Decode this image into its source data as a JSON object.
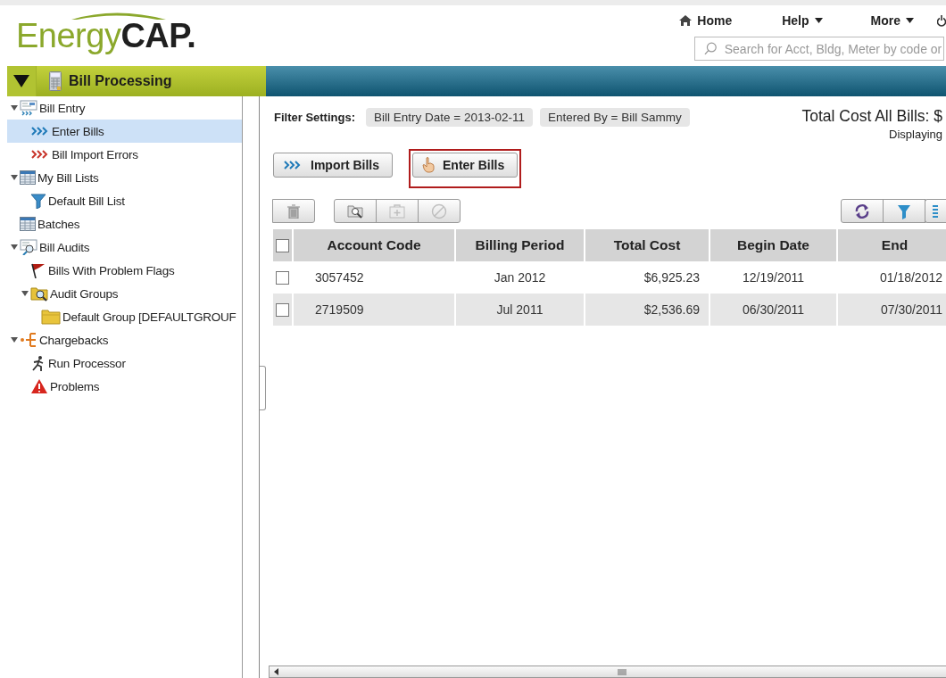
{
  "header": {
    "logo": "Energy**CAP.**",
    "nav": [
      {
        "label": "Home",
        "kind": "home"
      },
      {
        "label": "Help",
        "kind": "menu"
      },
      {
        "label": "More",
        "kind": "menu"
      },
      {
        "kind": "power"
      }
    ],
    "search": {
      "placeholder": "Search for Acct, Bldg, Meter by code or"
    }
  },
  "module_bar": {
    "title": "Bill Processing"
  },
  "sidebar": {
    "items": [
      {
        "label": "Bill Entry",
        "selected": false,
        "expanded": true,
        "children": [
          {
            "label": "Enter Bills",
            "selected": true
          },
          {
            "label": "Bill Import Errors",
            "selected": false
          }
        ]
      },
      {
        "label": "My Bill Lists",
        "selected": false,
        "expanded": true,
        "children": [
          {
            "label": "Default Bill List",
            "selected": false
          }
        ]
      },
      {
        "label": "Batches",
        "selected": false
      },
      {
        "label": "Bill Audits",
        "selected": false,
        "expanded": true,
        "children": [
          {
            "label": "Bills With Problem Flags",
            "selected": false
          },
          {
            "label": "Audit Groups",
            "selected": false,
            "expanded": true,
            "children": [
              {
                "label": "Default Group [DEFAULTGROUF",
                "selected": false
              }
            ]
          }
        ]
      },
      {
        "label": "Chargebacks",
        "selected": false,
        "expanded": true,
        "children": [
          {
            "label": "Run Processor",
            "selected": false
          },
          {
            "label": "Problems",
            "selected": false
          }
        ]
      }
    ]
  },
  "filter": {
    "label": "Filter Settings:",
    "chips": [
      "Bill Entry Date = 2013-02-11",
      "Entered By = Bill Sammy"
    ]
  },
  "summary": {
    "total": "Total Cost All Bills: $",
    "displaying": "Displaying"
  },
  "actions": [
    {
      "label": "Import Bills",
      "highlighted": false
    },
    {
      "label": "Enter Bills",
      "highlighted": true
    }
  ],
  "toolbar": [
    {
      "kind": "delete",
      "disabled": false
    },
    {
      "kind": "find",
      "disabled": false
    },
    {
      "kind": "add",
      "disabled": true
    },
    {
      "kind": "cancel",
      "disabled": true
    },
    {
      "kind": "refresh",
      "disabled": false
    },
    {
      "kind": "filter",
      "disabled": false
    },
    {
      "kind": "columns",
      "disabled": false
    }
  ],
  "table": {
    "header_checked": false,
    "columns": [
      "Account Code",
      "Billing Period",
      "Total Cost",
      "Begin Date",
      "End"
    ],
    "rows": [
      {
        "checked": false,
        "cells": [
          "3057452",
          "Jan 2012",
          "$6,925.23",
          "12/19/2011",
          "01/18/2012"
        ]
      },
      {
        "checked": false,
        "cells": [
          "2719509",
          "Jul 2011",
          "$2,536.69",
          "06/30/2011",
          "07/30/2011"
        ]
      }
    ]
  }
}
